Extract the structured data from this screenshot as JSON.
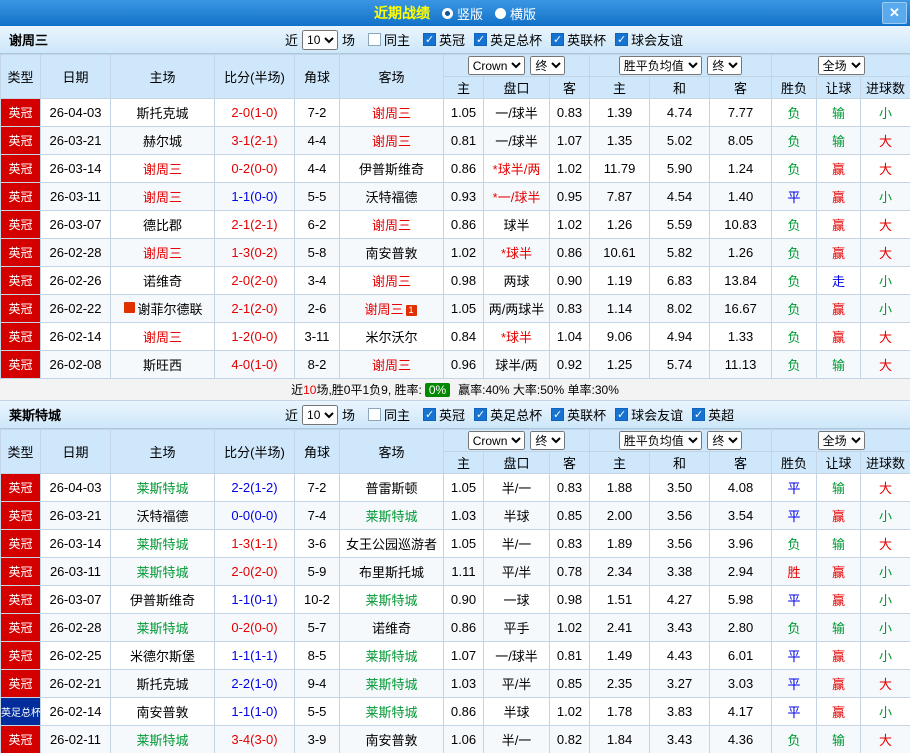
{
  "colors": {
    "titlebar_bg": "#1778d0",
    "title_text": "#ffff00",
    "section_bg": "#d5eafc",
    "table_head_bg": "#cfe7fb",
    "type_league_bg": "#d40000",
    "type_cup_bg": "#002d9b",
    "team_a_color": "#e60000",
    "team_b_color": "#009933",
    "win": "#e60000",
    "draw": "#0000e6",
    "loss": "#009933",
    "rate_badge_bg": "#008800"
  },
  "titlebar": {
    "title": "近期战绩",
    "layout_options": [
      {
        "label": "竖版",
        "checked": true
      },
      {
        "label": "横版",
        "checked": false
      }
    ],
    "close_label": "✕"
  },
  "filter": {
    "near": "近",
    "games": "10",
    "games_unit": "场",
    "same_home": "同主"
  },
  "table_header": {
    "type": "类型",
    "date": "日期",
    "home": "主场",
    "score": "比分(半场)",
    "corner": "角球",
    "away": "客场",
    "bookmaker_select": "Crown",
    "final_select_1": "终",
    "odds_home": "主",
    "handicap": "盘口",
    "odds_away": "客",
    "europe_select": "胜平负均值",
    "final_select_2": "终",
    "eu_home": "主",
    "eu_draw": "和",
    "eu_away": "客",
    "scope_select": "全场",
    "result": "胜负",
    "let_ball": "让球",
    "goals": "进球数"
  },
  "sections": [
    {
      "team": "谢周三",
      "leagues": [
        {
          "label": "英冠",
          "checked": true
        },
        {
          "label": "英足总杯",
          "checked": true
        },
        {
          "label": "英联杯",
          "checked": true
        },
        {
          "label": "球会友谊",
          "checked": true
        }
      ],
      "rows": [
        {
          "type": "英冠",
          "date": "26-04-03",
          "home": "斯托克城",
          "score": "2-0(1-0)",
          "corner": "7-2",
          "away": "谢周三",
          "o_home": "1.05",
          "handicap": "一/球半",
          "o_away": "0.83",
          "eu_home": "1.39",
          "eu_draw": "4.74",
          "eu_away": "7.77",
          "result": "负",
          "let_ball": "输",
          "goal": "小"
        },
        {
          "type": "英冠",
          "date": "26-03-21",
          "home": "赫尔城",
          "score": "3-1(2-1)",
          "corner": "4-4",
          "away": "谢周三",
          "o_home": "0.81",
          "handicap": "一/球半",
          "o_away": "1.07",
          "eu_home": "1.35",
          "eu_draw": "5.02",
          "eu_away": "8.05",
          "result": "负",
          "let_ball": "输",
          "goal": "大"
        },
        {
          "type": "英冠",
          "date": "26-03-14",
          "home": "谢周三",
          "score": "0-2(0-0)",
          "corner": "4-4",
          "away": "伊普斯维奇",
          "o_home": "0.86",
          "handicap": "*球半/两",
          "o_away": "1.02",
          "eu_home": "11.79",
          "eu_draw": "5.90",
          "eu_away": "1.24",
          "result": "负",
          "let_ball": "赢",
          "goal": "大"
        },
        {
          "type": "英冠",
          "date": "26-03-11",
          "home": "谢周三",
          "score": "1-1(0-0)",
          "corner": "5-5",
          "away": "沃特福德",
          "o_home": "0.93",
          "handicap": "*一/球半",
          "o_away": "0.95",
          "eu_home": "7.87",
          "eu_draw": "4.54",
          "eu_away": "1.40",
          "result": "平",
          "let_ball": "赢",
          "goal": "小"
        },
        {
          "type": "英冠",
          "date": "26-03-07",
          "home": "德比郡",
          "score": "2-1(2-1)",
          "corner": "6-2",
          "away": "谢周三",
          "o_home": "0.86",
          "handicap": "球半",
          "o_away": "1.02",
          "eu_home": "1.26",
          "eu_draw": "5.59",
          "eu_away": "10.83",
          "result": "负",
          "let_ball": "赢",
          "goal": "大"
        },
        {
          "type": "英冠",
          "date": "26-02-28",
          "home": "谢周三",
          "score": "1-3(0-2)",
          "corner": "5-8",
          "away": "南安普敦",
          "o_home": "1.02",
          "handicap": "*球半",
          "o_away": "0.86",
          "eu_home": "10.61",
          "eu_draw": "5.82",
          "eu_away": "1.26",
          "result": "负",
          "let_ball": "赢",
          "goal": "大"
        },
        {
          "type": "英冠",
          "date": "26-02-26",
          "home": "诺维奇",
          "score": "2-0(2-0)",
          "corner": "3-4",
          "away": "谢周三",
          "o_home": "0.98",
          "handicap": "两球",
          "o_away": "0.90",
          "eu_home": "1.19",
          "eu_draw": "6.83",
          "eu_away": "13.84",
          "result": "负",
          "let_ball": "走",
          "goal": "小"
        },
        {
          "type": "英冠",
          "date": "26-02-22",
          "home": "谢菲尔德联",
          "home_mark": "",
          "score": "2-1(2-0)",
          "corner": "2-6",
          "away": "谢周三",
          "away_mark": "1",
          "o_home": "1.05",
          "handicap": "两/两球半",
          "o_away": "0.83",
          "eu_home": "1.14",
          "eu_draw": "8.02",
          "eu_away": "16.67",
          "result": "负",
          "let_ball": "赢",
          "goal": "小"
        },
        {
          "type": "英冠",
          "date": "26-02-14",
          "home": "谢周三",
          "score": "1-2(0-0)",
          "corner": "3-11",
          "away": "米尔沃尔",
          "o_home": "0.84",
          "handicap": "*球半",
          "o_away": "1.04",
          "eu_home": "9.06",
          "eu_draw": "4.94",
          "eu_away": "1.33",
          "result": "负",
          "let_ball": "赢",
          "goal": "大"
        },
        {
          "type": "英冠",
          "date": "26-02-08",
          "home": "斯旺西",
          "score": "4-0(1-0)",
          "corner": "8-2",
          "away": "谢周三",
          "o_home": "0.96",
          "handicap": "球半/两",
          "o_away": "0.92",
          "eu_home": "1.25",
          "eu_draw": "5.74",
          "eu_away": "11.13",
          "result": "负",
          "let_ball": "输",
          "goal": "大"
        }
      ],
      "summary": {
        "pre": "近",
        "count": "10",
        "mid": "场,胜0平1负9, 胜率:",
        "rate": "0%",
        "post": "赢率:40% 大率:50% 单率:30%"
      }
    },
    {
      "team": "莱斯特城",
      "leagues": [
        {
          "label": "英冠",
          "checked": true
        },
        {
          "label": "英足总杯",
          "checked": true
        },
        {
          "label": "英联杯",
          "checked": true
        },
        {
          "label": "球会友谊",
          "checked": true
        },
        {
          "label": "英超",
          "checked": true
        }
      ],
      "rows": [
        {
          "type": "英冠",
          "date": "26-04-03",
          "home": "莱斯特城",
          "score": "2-2(1-2)",
          "corner": "7-2",
          "away": "普雷斯顿",
          "o_home": "1.05",
          "handicap": "半/一",
          "o_away": "0.83",
          "eu_home": "1.88",
          "eu_draw": "3.50",
          "eu_away": "4.08",
          "result": "平",
          "let_ball": "输",
          "goal": "大"
        },
        {
          "type": "英冠",
          "date": "26-03-21",
          "home": "沃特福德",
          "score": "0-0(0-0)",
          "corner": "7-4",
          "away": "莱斯特城",
          "o_home": "1.03",
          "handicap": "半球",
          "o_away": "0.85",
          "eu_home": "2.00",
          "eu_draw": "3.56",
          "eu_away": "3.54",
          "result": "平",
          "let_ball": "赢",
          "goal": "小"
        },
        {
          "type": "英冠",
          "date": "26-03-14",
          "home": "莱斯特城",
          "score": "1-3(1-1)",
          "corner": "3-6",
          "away": "女王公园巡游者",
          "o_home": "1.05",
          "handicap": "半/一",
          "o_away": "0.83",
          "eu_home": "1.89",
          "eu_draw": "3.56",
          "eu_away": "3.96",
          "result": "负",
          "let_ball": "输",
          "goal": "大"
        },
        {
          "type": "英冠",
          "date": "26-03-11",
          "home": "莱斯特城",
          "score": "2-0(2-0)",
          "corner": "5-9",
          "away": "布里斯托城",
          "o_home": "1.11",
          "handicap": "平/半",
          "o_away": "0.78",
          "eu_home": "2.34",
          "eu_draw": "3.38",
          "eu_away": "2.94",
          "result": "胜",
          "let_ball": "赢",
          "goal": "小"
        },
        {
          "type": "英冠",
          "date": "26-03-07",
          "home": "伊普斯维奇",
          "score": "1-1(0-1)",
          "corner": "10-2",
          "away": "莱斯特城",
          "o_home": "0.90",
          "handicap": "一球",
          "o_away": "0.98",
          "eu_home": "1.51",
          "eu_draw": "4.27",
          "eu_away": "5.98",
          "result": "平",
          "let_ball": "赢",
          "goal": "小"
        },
        {
          "type": "英冠",
          "date": "26-02-28",
          "home": "莱斯特城",
          "score": "0-2(0-0)",
          "corner": "5-7",
          "away": "诺维奇",
          "o_home": "0.86",
          "handicap": "平手",
          "o_away": "1.02",
          "eu_home": "2.41",
          "eu_draw": "3.43",
          "eu_away": "2.80",
          "result": "负",
          "let_ball": "输",
          "goal": "小"
        },
        {
          "type": "英冠",
          "date": "26-02-25",
          "home": "米德尔斯堡",
          "score": "1-1(1-1)",
          "corner": "8-5",
          "away": "莱斯特城",
          "o_home": "1.07",
          "handicap": "一/球半",
          "o_away": "0.81",
          "eu_home": "1.49",
          "eu_draw": "4.43",
          "eu_away": "6.01",
          "result": "平",
          "let_ball": "赢",
          "goal": "小"
        },
        {
          "type": "英冠",
          "date": "26-02-21",
          "home": "斯托克城",
          "score": "2-2(1-0)",
          "corner": "9-4",
          "away": "莱斯特城",
          "o_home": "1.03",
          "handicap": "平/半",
          "o_away": "0.85",
          "eu_home": "2.35",
          "eu_draw": "3.27",
          "eu_away": "3.03",
          "result": "平",
          "let_ball": "赢",
          "goal": "大"
        },
        {
          "type": "英足总杯",
          "date": "26-02-14",
          "home": "南安普敦",
          "score": "1-1(1-0)",
          "corner": "5-5",
          "away": "莱斯特城",
          "o_home": "0.86",
          "handicap": "半球",
          "o_away": "1.02",
          "eu_home": "1.78",
          "eu_draw": "3.83",
          "eu_away": "4.17",
          "result": "平",
          "let_ball": "赢",
          "goal": "小"
        },
        {
          "type": "英冠",
          "date": "26-02-11",
          "home": "莱斯特城",
          "score": "3-4(3-0)",
          "corner": "3-9",
          "away": "南安普敦",
          "o_home": "1.06",
          "handicap": "半/一",
          "o_away": "0.82",
          "eu_home": "1.84",
          "eu_draw": "3.43",
          "eu_away": "4.36",
          "result": "负",
          "let_ball": "输",
          "goal": "大"
        }
      ]
    }
  ]
}
